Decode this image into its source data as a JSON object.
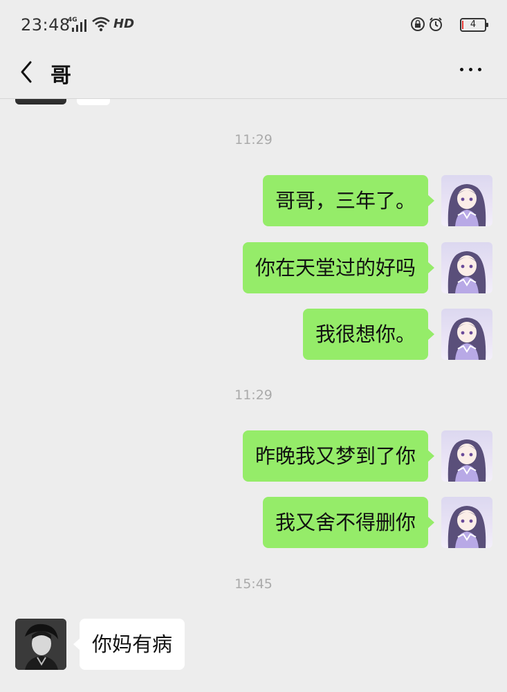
{
  "status_bar": {
    "time": "23:48",
    "network": "4G",
    "hd_label": "HD",
    "battery": "4"
  },
  "header": {
    "title": "哥"
  },
  "chat": {
    "timestamps": [
      "11:29",
      "11:29",
      "15:45"
    ],
    "messages": [
      {
        "side": "right",
        "text": "哥哥，三年了。"
      },
      {
        "side": "right",
        "text": "你在天堂过的好吗"
      },
      {
        "side": "right",
        "text": "我很想你。"
      },
      {
        "side": "right",
        "text": "昨晚我又梦到了你"
      },
      {
        "side": "right",
        "text": "我又舍不得删你"
      },
      {
        "side": "left",
        "text": "你妈有病"
      }
    ]
  },
  "colors": {
    "background": "#ededed",
    "sent_bubble": "#95ec69",
    "received_bubble": "#ffffff",
    "timestamp": "#aaaaaa"
  },
  "icons": [
    "back-chevron-icon",
    "more-icon",
    "signal-icon",
    "wifi-icon",
    "lock-rotation-icon",
    "alarm-icon",
    "battery-icon"
  ]
}
